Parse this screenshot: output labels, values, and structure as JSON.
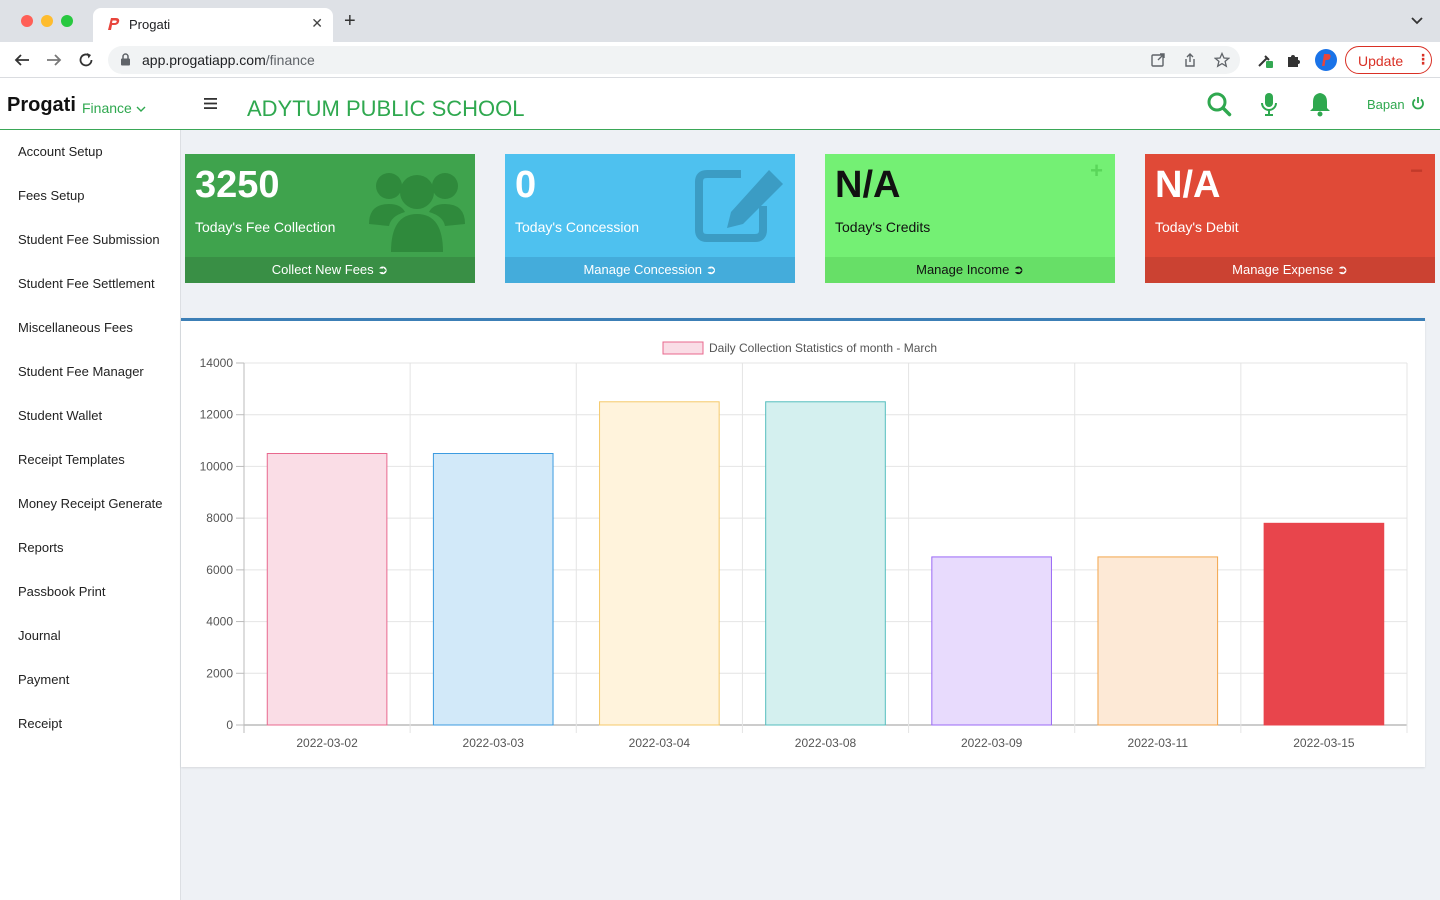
{
  "browser": {
    "tab_title": "Progati",
    "url_host": "app.progatiapp.com",
    "url_path": "/finance",
    "update_label": "Update"
  },
  "header": {
    "brand": "Progati",
    "module": "Finance",
    "school": "ADYTUM PUBLIC SCHOOL",
    "user": "Bapan"
  },
  "sidebar": {
    "items": [
      {
        "label": "Account Setup"
      },
      {
        "label": "Fees Setup"
      },
      {
        "label": "Student Fee Submission"
      },
      {
        "label": "Student Fee Settlement"
      },
      {
        "label": "Miscellaneous Fees"
      },
      {
        "label": "Student Fee Manager"
      },
      {
        "label": "Student Wallet"
      },
      {
        "label": "Receipt Templates"
      },
      {
        "label": "Money Receipt Generate"
      },
      {
        "label": "Reports"
      },
      {
        "label": "Passbook Print"
      },
      {
        "label": "Journal"
      },
      {
        "label": "Payment"
      },
      {
        "label": "Receipt"
      }
    ]
  },
  "cards": {
    "fee": {
      "value": "3250",
      "label": "Today's Fee Collection",
      "link": "Collect New Fees"
    },
    "concession": {
      "value": "0",
      "label": "Today's Concession",
      "link": "Manage Concession"
    },
    "credits": {
      "value": "N/A",
      "label": "Today's Credits",
      "link": "Manage Income"
    },
    "debit": {
      "value": "N/A",
      "label": "Today's Debit",
      "link": "Manage Expense"
    }
  },
  "colors": {
    "accent": "#2fa84f",
    "card_fee": "#3fa34d",
    "card_concession": "#4ec1ef",
    "card_credits": "#74f074",
    "card_debit": "#e04a37"
  },
  "chart_data": {
    "type": "bar",
    "legend": "Daily Collection Statistics of month - March",
    "legend_position": "top",
    "categories": [
      "2022-03-02",
      "2022-03-03",
      "2022-03-04",
      "2022-03-08",
      "2022-03-09",
      "2022-03-11",
      "2022-03-15"
    ],
    "values": [
      10500,
      10500,
      12500,
      12500,
      6500,
      6500,
      7800
    ],
    "ylim": [
      0,
      14000
    ],
    "yticks": [
      0,
      2000,
      4000,
      6000,
      8000,
      10000,
      12000,
      14000
    ],
    "grid": true,
    "fills": [
      "#fadde6",
      "#d2e9f9",
      "#fff3dc",
      "#d4f0ef",
      "#e8dbfd",
      "#fde9d6",
      "#e8454c"
    ],
    "strokes": [
      "#e8688e",
      "#3c9be0",
      "#f5c96a",
      "#53bdbd",
      "#9a68f5",
      "#f3a54c",
      "#e8454c"
    ]
  }
}
